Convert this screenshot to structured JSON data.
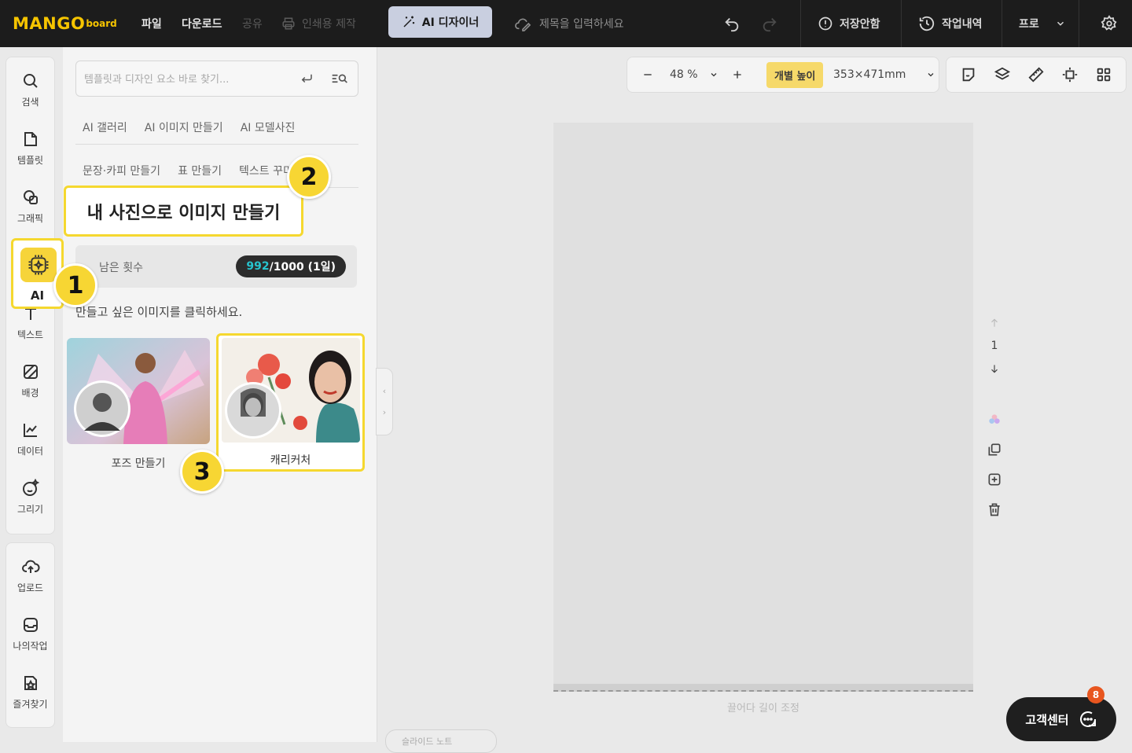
{
  "topbar": {
    "logo_main": "MANGO",
    "logo_sub": "board",
    "menu": [
      "파일",
      "다운로드"
    ],
    "menu_disabled": [
      "공유",
      "인쇄용 제작"
    ],
    "ai_designer": "AI 디자이너",
    "title_placeholder": "제목을 입력하세요",
    "save_status": "저장안함",
    "history": "작업내역",
    "plan": "프로"
  },
  "rail": {
    "items": [
      "검색",
      "템플릿",
      "그래픽",
      "AI",
      "텍스트",
      "배경",
      "데이터",
      "그리기"
    ],
    "items2": [
      "업로드",
      "나의작업",
      "즐겨찾기"
    ]
  },
  "panel": {
    "search_placeholder": "템플릿과 디자인 요소 바로 찾기...",
    "tabs_row1": [
      "AI 갤러리",
      "AI 이미지 만들기",
      "AI 모델사진"
    ],
    "tabs_row2": [
      "문장·카피 만들기",
      "표 만들기",
      "텍스트 꾸미"
    ],
    "remaining_label": "남은 횟수",
    "remaining_used": "992",
    "remaining_total": "/1000 (1일)",
    "instruction": "만들고 싶은 이미지를 클릭하세요.",
    "cards": [
      "포즈 만들기",
      "캐리커처"
    ]
  },
  "canvas": {
    "zoom": "48 %",
    "individual_height": "개별 높이",
    "size": "353×471mm",
    "page_number": "1",
    "drag_hint": "끌어다 길이 조정",
    "bottom_tab": "슬라이드 노트"
  },
  "support": {
    "label": "고객센터",
    "badge": "8"
  },
  "tutorial": {
    "callout": "내 사진으로 이미지 만들기",
    "steps": [
      "1",
      "2",
      "3"
    ]
  },
  "colors": {
    "accent_yellow": "#f5d82f",
    "topbar_bg": "#1c1c1c",
    "teal": "#27c4cf",
    "badge_orange": "#e8561f"
  }
}
